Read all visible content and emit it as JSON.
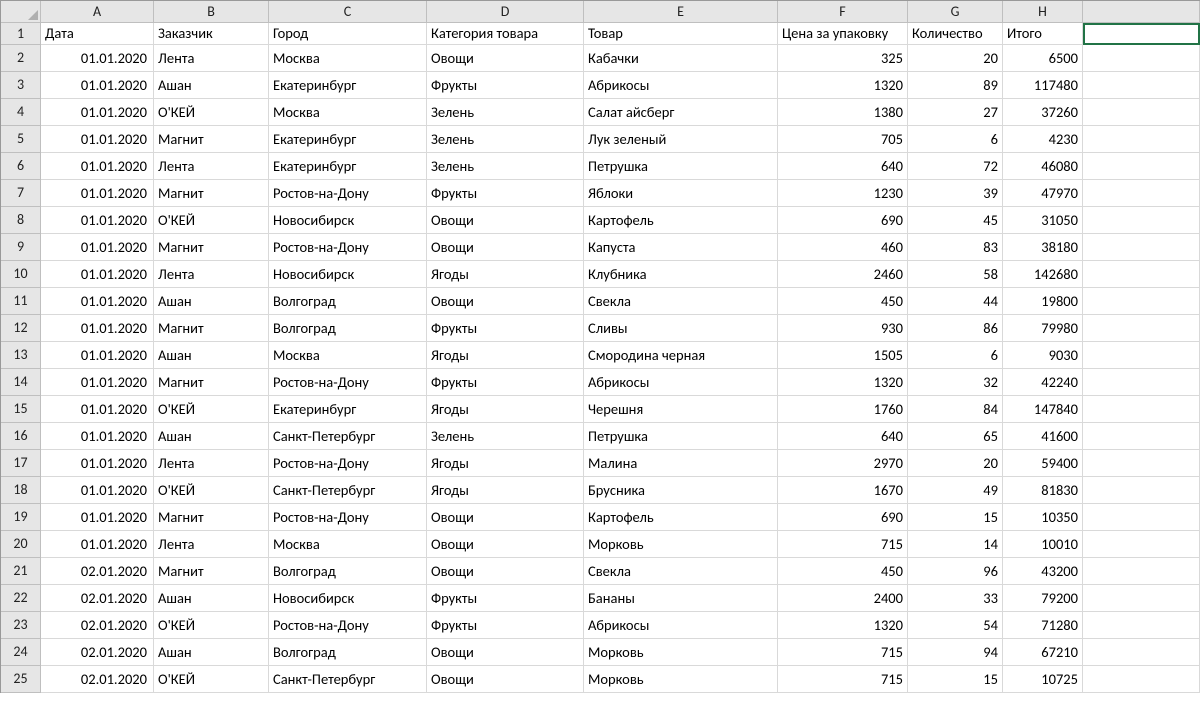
{
  "columns": [
    "A",
    "B",
    "C",
    "D",
    "E",
    "F",
    "G",
    "H",
    ""
  ],
  "headers": [
    "Дата",
    "Заказчик",
    "Город",
    "Категория товара",
    "Товар",
    "Цена за упаковку",
    "Количество",
    "Итого"
  ],
  "active_cell": "I1",
  "rows": [
    {
      "n": 2,
      "date": "01.01.2020",
      "cust": "Лента",
      "city": "Москва",
      "cat": "Овощи",
      "prod": "Кабачки",
      "price": 325,
      "qty": 20,
      "tot": 6500
    },
    {
      "n": 3,
      "date": "01.01.2020",
      "cust": "Ашан",
      "city": "Екатеринбург",
      "cat": "Фрукты",
      "prod": "Абрикосы",
      "price": 1320,
      "qty": 89,
      "tot": 117480
    },
    {
      "n": 4,
      "date": "01.01.2020",
      "cust": "О'КЕЙ",
      "city": "Москва",
      "cat": "Зелень",
      "prod": "Салат айсберг",
      "price": 1380,
      "qty": 27,
      "tot": 37260
    },
    {
      "n": 5,
      "date": "01.01.2020",
      "cust": "Магнит",
      "city": "Екатеринбург",
      "cat": "Зелень",
      "prod": "Лук зеленый",
      "price": 705,
      "qty": 6,
      "tot": 4230
    },
    {
      "n": 6,
      "date": "01.01.2020",
      "cust": "Лента",
      "city": "Екатеринбург",
      "cat": "Зелень",
      "prod": "Петрушка",
      "price": 640,
      "qty": 72,
      "tot": 46080
    },
    {
      "n": 7,
      "date": "01.01.2020",
      "cust": "Магнит",
      "city": "Ростов-на-Дону",
      "cat": "Фрукты",
      "prod": "Яблоки",
      "price": 1230,
      "qty": 39,
      "tot": 47970
    },
    {
      "n": 8,
      "date": "01.01.2020",
      "cust": "О'КЕЙ",
      "city": "Новосибирск",
      "cat": "Овощи",
      "prod": "Картофель",
      "price": 690,
      "qty": 45,
      "tot": 31050
    },
    {
      "n": 9,
      "date": "01.01.2020",
      "cust": "Магнит",
      "city": "Ростов-на-Дону",
      "cat": "Овощи",
      "prod": "Капуста",
      "price": 460,
      "qty": 83,
      "tot": 38180
    },
    {
      "n": 10,
      "date": "01.01.2020",
      "cust": "Лента",
      "city": "Новосибирск",
      "cat": "Ягоды",
      "prod": "Клубника",
      "price": 2460,
      "qty": 58,
      "tot": 142680
    },
    {
      "n": 11,
      "date": "01.01.2020",
      "cust": "Ашан",
      "city": "Волгоград",
      "cat": "Овощи",
      "prod": "Свекла",
      "price": 450,
      "qty": 44,
      "tot": 19800
    },
    {
      "n": 12,
      "date": "01.01.2020",
      "cust": "Магнит",
      "city": "Волгоград",
      "cat": "Фрукты",
      "prod": "Сливы",
      "price": 930,
      "qty": 86,
      "tot": 79980
    },
    {
      "n": 13,
      "date": "01.01.2020",
      "cust": "Ашан",
      "city": "Москва",
      "cat": "Ягоды",
      "prod": "Смородина черная",
      "price": 1505,
      "qty": 6,
      "tot": 9030
    },
    {
      "n": 14,
      "date": "01.01.2020",
      "cust": "Магнит",
      "city": "Ростов-на-Дону",
      "cat": "Фрукты",
      "prod": "Абрикосы",
      "price": 1320,
      "qty": 32,
      "tot": 42240
    },
    {
      "n": 15,
      "date": "01.01.2020",
      "cust": "О'КЕЙ",
      "city": "Екатеринбург",
      "cat": "Ягоды",
      "prod": "Черешня",
      "price": 1760,
      "qty": 84,
      "tot": 147840
    },
    {
      "n": 16,
      "date": "01.01.2020",
      "cust": "Ашан",
      "city": "Санкт-Петербург",
      "cat": "Зелень",
      "prod": "Петрушка",
      "price": 640,
      "qty": 65,
      "tot": 41600
    },
    {
      "n": 17,
      "date": "01.01.2020",
      "cust": "Лента",
      "city": "Ростов-на-Дону",
      "cat": "Ягоды",
      "prod": "Малина",
      "price": 2970,
      "qty": 20,
      "tot": 59400
    },
    {
      "n": 18,
      "date": "01.01.2020",
      "cust": "О'КЕЙ",
      "city": "Санкт-Петербург",
      "cat": "Ягоды",
      "prod": "Брусника",
      "price": 1670,
      "qty": 49,
      "tot": 81830
    },
    {
      "n": 19,
      "date": "01.01.2020",
      "cust": "Магнит",
      "city": "Ростов-на-Дону",
      "cat": "Овощи",
      "prod": "Картофель",
      "price": 690,
      "qty": 15,
      "tot": 10350
    },
    {
      "n": 20,
      "date": "01.01.2020",
      "cust": "Лента",
      "city": "Москва",
      "cat": "Овощи",
      "prod": "Морковь",
      "price": 715,
      "qty": 14,
      "tot": 10010
    },
    {
      "n": 21,
      "date": "02.01.2020",
      "cust": "Магнит",
      "city": "Волгоград",
      "cat": "Овощи",
      "prod": "Свекла",
      "price": 450,
      "qty": 96,
      "tot": 43200
    },
    {
      "n": 22,
      "date": "02.01.2020",
      "cust": "Ашан",
      "city": "Новосибирск",
      "cat": "Фрукты",
      "prod": "Бананы",
      "price": 2400,
      "qty": 33,
      "tot": 79200
    },
    {
      "n": 23,
      "date": "02.01.2020",
      "cust": "О'КЕЙ",
      "city": "Ростов-на-Дону",
      "cat": "Фрукты",
      "prod": "Абрикосы",
      "price": 1320,
      "qty": 54,
      "tot": 71280
    },
    {
      "n": 24,
      "date": "02.01.2020",
      "cust": "Ашан",
      "city": "Волгоград",
      "cat": "Овощи",
      "prod": "Морковь",
      "price": 715,
      "qty": 94,
      "tot": 67210
    },
    {
      "n": 25,
      "date": "02.01.2020",
      "cust": "О'КЕЙ",
      "city": "Санкт-Петербург",
      "cat": "Овощи",
      "prod": "Морковь",
      "price": 715,
      "qty": 15,
      "tot": 10725
    }
  ]
}
